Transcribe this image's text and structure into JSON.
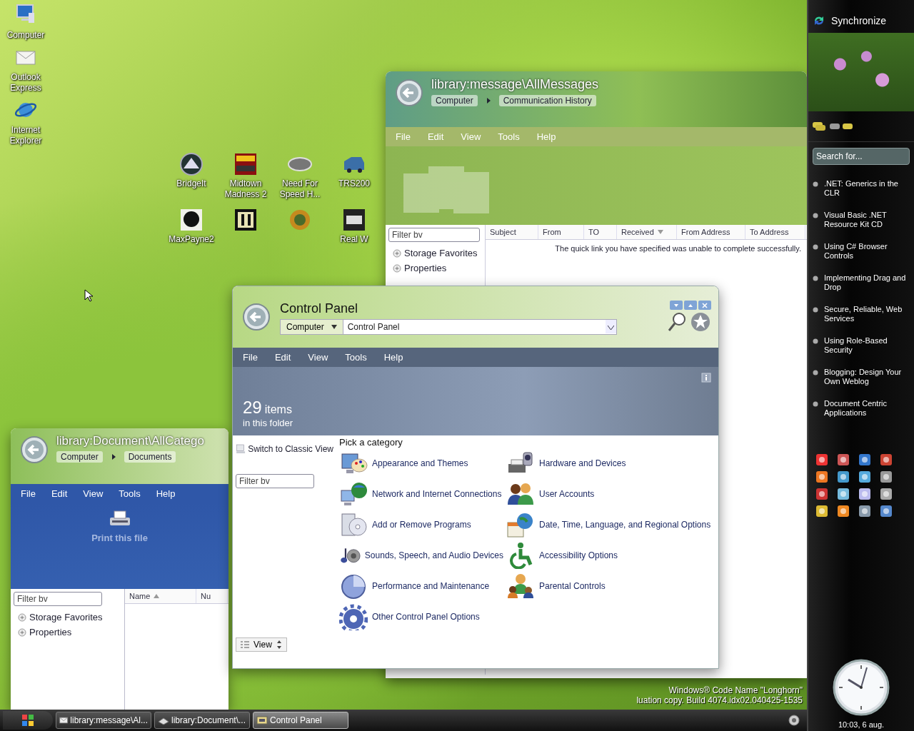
{
  "desktop_icons": [
    {
      "label": "Computer",
      "kind": "computer"
    },
    {
      "label": "Outlook Express",
      "kind": "mail"
    },
    {
      "label": "Internet Explorer",
      "kind": "browser"
    }
  ],
  "shortcuts": [
    {
      "label": "BridgeIt",
      "kind": "bridge"
    },
    {
      "label": "Midtown Madness 2",
      "kind": "racing"
    },
    {
      "label": "Need For Speed H...",
      "kind": "badge"
    },
    {
      "label": "TRS200",
      "kind": "truck"
    },
    {
      "label": "MaxPayne2",
      "kind": "portrait"
    },
    {
      "kind": "letters"
    },
    {
      "kind": "emblem"
    },
    {
      "label": "Real W",
      "kind": "logo"
    }
  ],
  "message_window": {
    "title": "library:message\\AllMessages",
    "breadcrumb": [
      "Computer",
      "Communication History"
    ],
    "menu": [
      "File",
      "Edit",
      "View",
      "Tools",
      "Help"
    ],
    "filter": {
      "placeholder": "Filter bv"
    },
    "tree": [
      "Storage Favorites",
      "Properties"
    ],
    "columns": [
      {
        "label": "Subject",
        "sorted": false
      },
      {
        "label": "From",
        "sorted": false
      },
      {
        "label": "TO",
        "sorted": false
      },
      {
        "label": "Received",
        "sorted": true,
        "ascending": false
      },
      {
        "label": "From Address",
        "sorted": false
      },
      {
        "label": "To Address",
        "sorted": false
      }
    ],
    "notice": "The quick link you have specified was unable to complete successfully."
  },
  "document_window": {
    "title": "library:Document\\AllCatego",
    "breadcrumb": [
      "Computer",
      "Documents"
    ],
    "menu": [
      "File",
      "Edit",
      "View",
      "Tools",
      "Help"
    ],
    "task": "Print this file",
    "filter": {
      "placeholder": "Filter bv"
    },
    "tree": [
      "Storage Favorites",
      "Properties"
    ],
    "columns": [
      {
        "label": "Name",
        "sorted": true,
        "ascending": true
      },
      {
        "label": "Nu",
        "sorted": false
      }
    ]
  },
  "control_panel": {
    "title": "Control Panel",
    "address_root": "Computer",
    "address_path": "Control Panel",
    "menu": [
      "File",
      "Edit",
      "View",
      "Tools",
      "Help"
    ],
    "item_count": "29",
    "count_unit": "items",
    "count_caption": "in this folder",
    "task": "Switch to Classic View",
    "filter": {
      "placeholder": "Filter bv"
    },
    "heading": "Pick a category",
    "categories": [
      {
        "label": "Appearance and Themes",
        "kind": "appearance"
      },
      {
        "label": "Network and Internet Connections",
        "kind": "network"
      },
      {
        "label": "Add or Remove Programs",
        "kind": "programs"
      },
      {
        "label": "Sounds, Speech, and Audio Devices",
        "kind": "sounds"
      },
      {
        "label": "Performance and Maintenance",
        "kind": "performance"
      },
      {
        "label": "Other Control Panel Options",
        "kind": "other"
      },
      {
        "label": "Hardware and Devices",
        "kind": "hardware"
      },
      {
        "label": "User Accounts",
        "kind": "users"
      },
      {
        "label": "Date, Time, Language, and Regional Options",
        "kind": "datetime"
      },
      {
        "label": "Accessibility Options",
        "kind": "accessibility"
      },
      {
        "label": "Parental Controls",
        "kind": "parental"
      }
    ],
    "view_button": "View"
  },
  "watermark": [
    "Windows® Code Name \"Longhorn\"",
    "luation copy. Build 4074.idx02.040425-1535"
  ],
  "sidebar": {
    "title": "Synchronize",
    "search": {
      "placeholder": "Search for..."
    },
    "items": [
      ".NET: Generics in the CLR",
      "Visual Basic .NET Resource Kit CD",
      "Using C# Browser Controls",
      "Implementing Drag and Drop",
      "Secure, Reliable, Web Services",
      "Using Role-Based Security",
      "Blogging: Design Your Own Weblog",
      "Document Centric Applications"
    ],
    "clock": "10:03, 6 aug."
  },
  "taskbar": {
    "tasks": [
      {
        "label": "library:message\\Al...",
        "kind": "mail",
        "selected": false
      },
      {
        "label": "library:Document\\...",
        "kind": "document",
        "selected": false
      },
      {
        "label": "Control Panel",
        "kind": "controlpanel",
        "selected": true
      }
    ]
  }
}
